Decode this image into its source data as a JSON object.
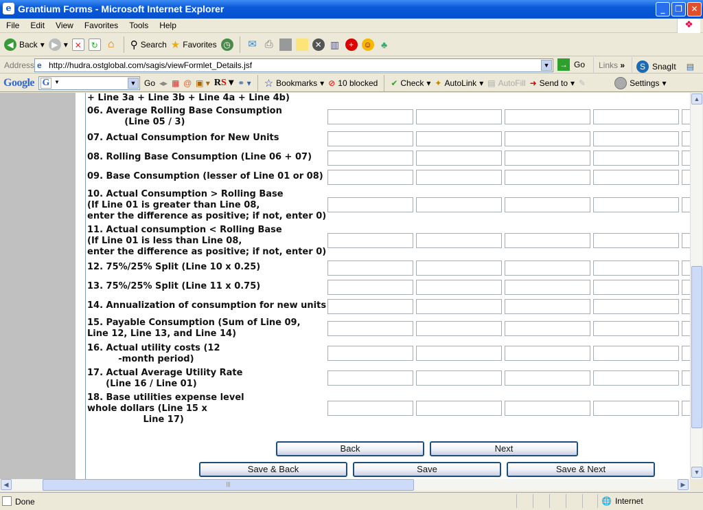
{
  "window": {
    "title": "Grantium Forms - Microsoft Internet Explorer"
  },
  "menu": [
    "File",
    "Edit",
    "View",
    "Favorites",
    "Tools",
    "Help"
  ],
  "toolbar": {
    "back": "Back",
    "search": "Search",
    "favorites": "Favorites"
  },
  "address": {
    "label": "Address",
    "url": "http://hudra.ostglobal.com/sagis/viewFormlet_Details.jsf",
    "go": "Go",
    "links": "Links",
    "snagit": "SnagIt"
  },
  "google_bar": {
    "logo": "Google",
    "go": "Go",
    "bookmarks": "Bookmarks",
    "blocked": "10 blocked",
    "check": "Check",
    "autolink": "AutoLink",
    "autofill": "AutoFill",
    "send_to": "Send to",
    "settings": "Settings"
  },
  "form": {
    "continued_line": "+ Line 3a + Line 3b + Line 4a + Line 4b)",
    "rows": [
      {
        "label": "06. Average Rolling Base Consumption\n            (Line 05 / 3)"
      },
      {
        "label": "07. Actual Consumption for New Units"
      },
      {
        "label": "08. Rolling Base Consumption (Line 06 + 07)"
      },
      {
        "label": "09. Base Consumption (lesser of Line 01 or 08)"
      },
      {
        "label": "10. Actual Consumption > Rolling Base\n(If Line 01 is greater than Line 08,\nenter the difference as positive; if not, enter 0)"
      },
      {
        "label": "11. Actual consumption < Rolling Base\n(If Line 01 is less than Line 08,\nenter the difference as positive; if not, enter 0)"
      },
      {
        "label": "12. 75%/25% Split (Line 10 x 0.25)"
      },
      {
        "label": "13. 75%/25% Split (Line 11 x 0.75)"
      },
      {
        "label": "14. Annualization of consumption for new units"
      },
      {
        "label": "15. Payable Consumption (Sum of Line 09,\nLine 12, Line 13, and Line 14)"
      },
      {
        "label": "16. Actual utility costs (12\n          -month period)"
      },
      {
        "label": "17. Actual Average Utility Rate\n      (Line 16 / Line 01)"
      },
      {
        "label": "18. Base utilities expense level\nwhole dollars (Line 15 x\n                  Line 17)"
      }
    ],
    "buttons": {
      "back": "Back",
      "next": "Next",
      "save_back": "Save & Back",
      "save": "Save",
      "save_next": "Save & Next"
    }
  },
  "status": {
    "text": "Done",
    "zone": "Internet"
  }
}
